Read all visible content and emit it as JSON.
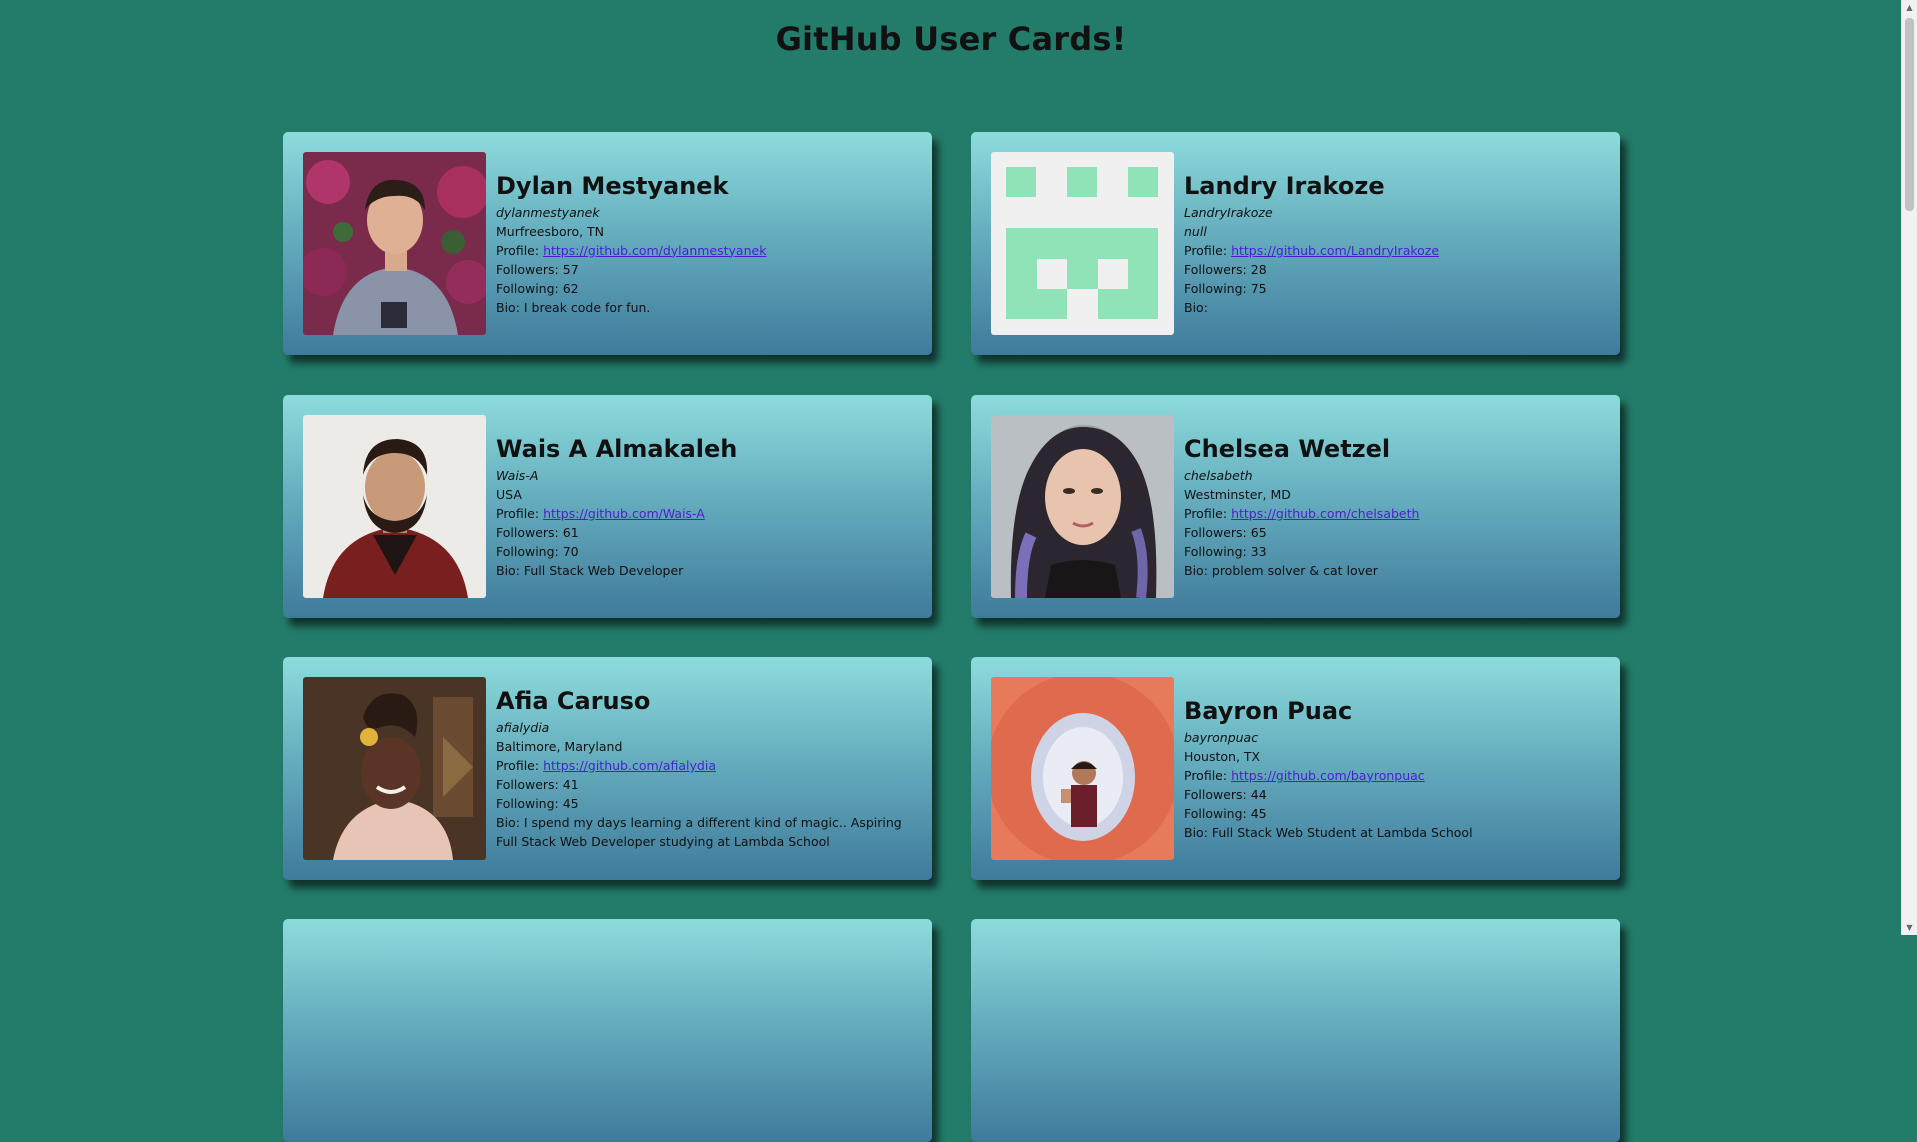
{
  "page": {
    "title": "GitHub User Cards!"
  },
  "cards": [
    {
      "name": "Dylan Mestyanek",
      "username": "dylanmestyanek",
      "location": "Murfreesboro, TN",
      "profile_label": "Profile:",
      "profile_url": "https://github.com/dylanmestyanek",
      "followers": "Followers: 57",
      "following": "Following: 62",
      "bio": "Bio: I break code for fun."
    },
    {
      "name": "Landry Irakoze",
      "username": "LandryIrakoze",
      "location": "null",
      "profile_label": "Profile:",
      "profile_url": "https://github.com/LandryIrakoze",
      "followers": "Followers: 28",
      "following": "Following: 75",
      "bio": "Bio:"
    },
    {
      "name": "Wais A Almakaleh",
      "username": "Wais-A",
      "location": "USA",
      "profile_label": "Profile:",
      "profile_url": "https://github.com/Wais-A",
      "followers": "Followers: 61",
      "following": "Following: 70",
      "bio": "Bio: Full Stack Web Developer"
    },
    {
      "name": "Chelsea Wetzel",
      "username": "chelsabeth",
      "location": "Westminster, MD",
      "profile_label": "Profile:",
      "profile_url": "https://github.com/chelsabeth",
      "followers": "Followers: 65",
      "following": "Following: 33",
      "bio": "Bio: problem solver & cat lover"
    },
    {
      "name": "Afia Caruso",
      "username": "afialydia",
      "location": "Baltimore, Maryland",
      "profile_label": "Profile:",
      "profile_url": "https://github.com/afialydia",
      "followers": "Followers: 41",
      "following": "Following: 45",
      "bio": "Bio: I spend my days learning a different kind of magic.. Aspiring Full Stack Web Developer studying at Lambda School"
    },
    {
      "name": "Bayron Puac",
      "username": "bayronpuac",
      "location": "Houston, TX",
      "profile_label": "Profile:",
      "profile_url": "https://github.com/bayronpuac",
      "followers": "Followers: 44",
      "following": "Following: 45",
      "bio": "Bio: Full Stack Web Student at Lambda School"
    }
  ],
  "colors": {
    "background": "#237c6a",
    "card_top": "#8ddcdc",
    "card_bottom": "#3f7a9b",
    "link": "#4a1fd4",
    "identicon": "#8fe3b6"
  }
}
